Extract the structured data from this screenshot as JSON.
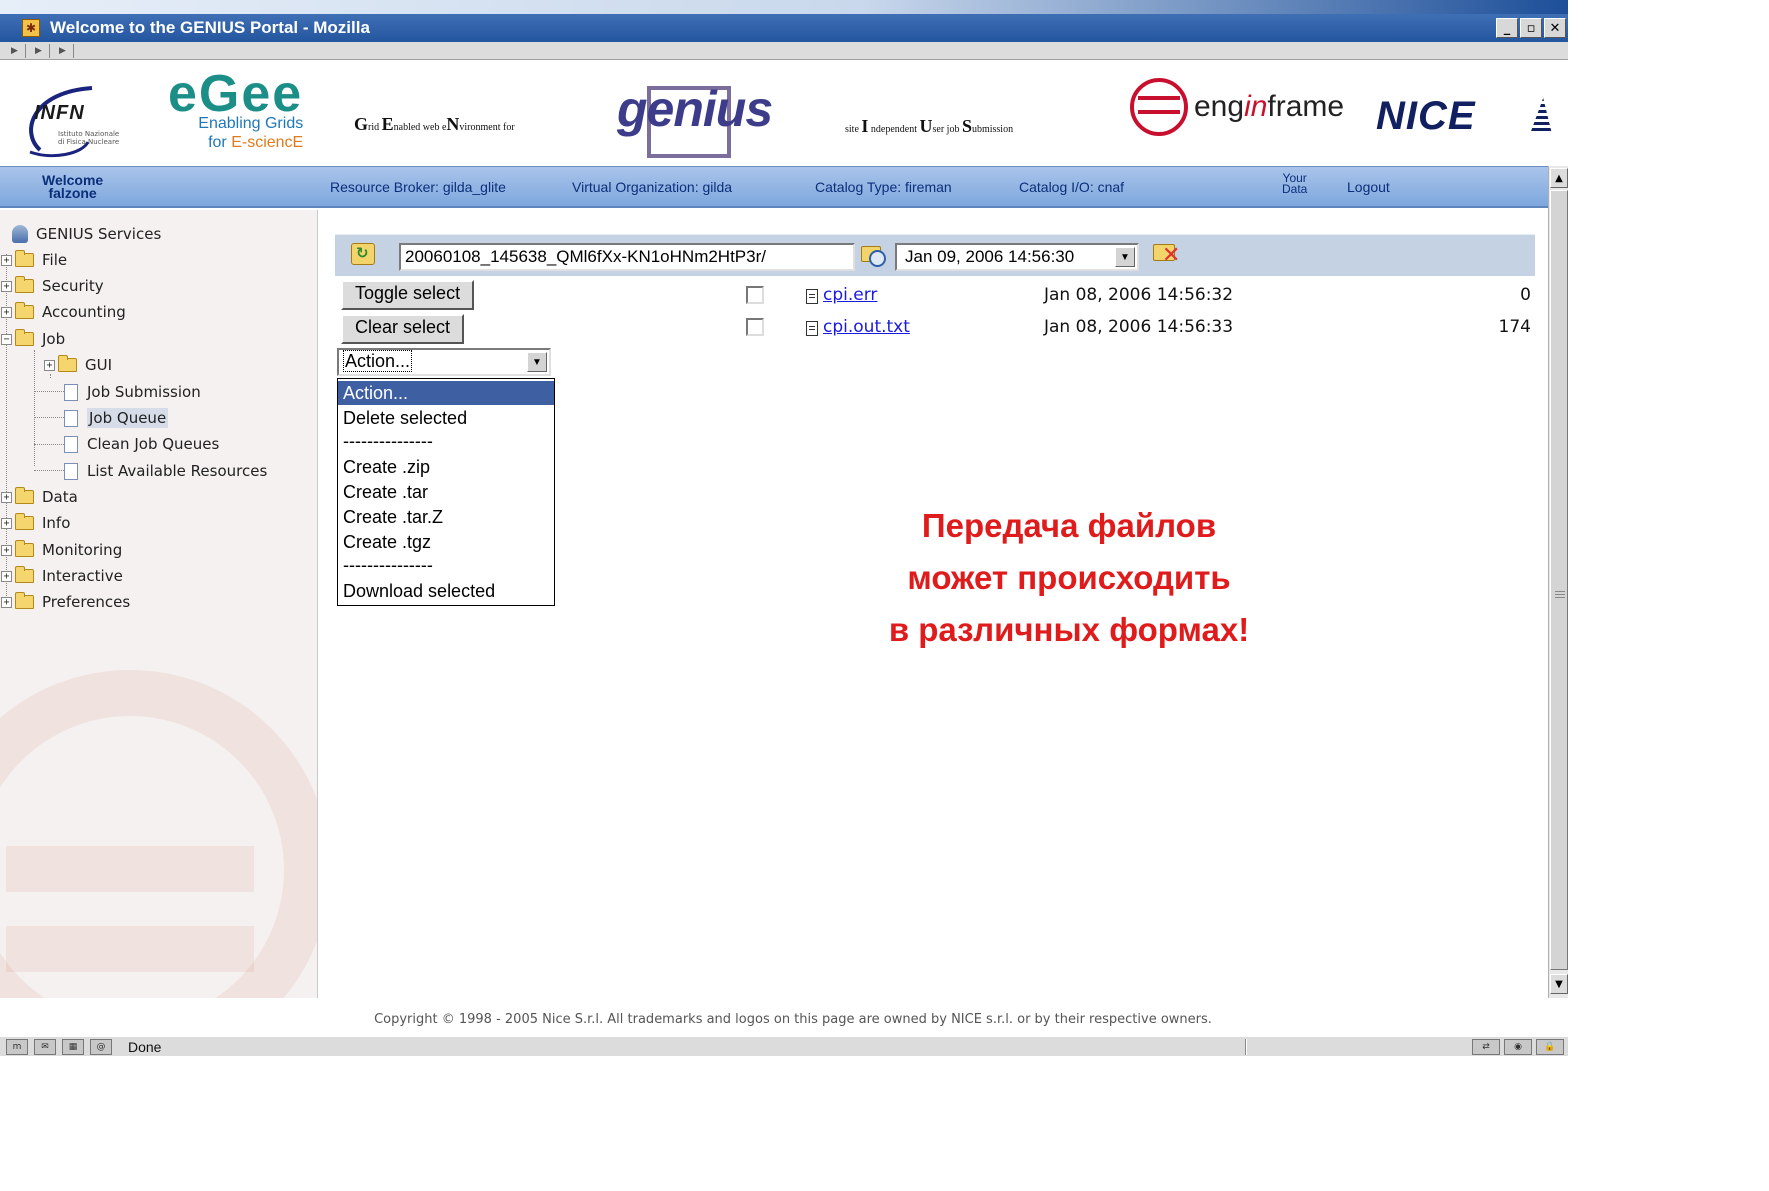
{
  "window": {
    "title": "Welcome to the GENIUS Portal - Mozilla",
    "controls": [
      "minimize",
      "maximize",
      "close"
    ]
  },
  "banner": {
    "infn": {
      "name": "INFN",
      "subtitle_1": "Istituto Nazionale",
      "subtitle_2": "di Fisica Nucleare"
    },
    "egee": {
      "brand": "eGee",
      "line1": "Enabling Grids",
      "line2_prefix": "for ",
      "line2_highlight": "E-sciencE"
    },
    "genius_tagline": {
      "g": "G",
      "g_rest": "rid ",
      "e": "E",
      "e_rest": "nabled web e",
      "n": "N",
      "n_rest": "vironment for"
    },
    "genius_logo": "genius",
    "site_tagline": {
      "p1": "site ",
      "i": "I",
      "p2": " ndependent ",
      "u": "U",
      "p3": "ser job ",
      "s": "S",
      "p4": "ubmission"
    },
    "enginframe": {
      "pre": "eng",
      "mid": "in",
      "post": "frame"
    },
    "nice": "NICE"
  },
  "infobar": {
    "welcome_line1": "Welcome",
    "welcome_line2": "falzone",
    "resource_broker": "Resource Broker: gilda_glite",
    "virtual_org": "Virtual Organization: gilda",
    "catalog_type": "Catalog Type: fireman",
    "catalog_io": "Catalog I/O: cnaf",
    "your_data_1": "Your",
    "your_data_2": "Data",
    "logout": "Logout"
  },
  "sidebar": {
    "root": "GENIUS Services",
    "items": {
      "file": "File",
      "security": "Security",
      "accounting": "Accounting",
      "job": "Job",
      "gui": "GUI",
      "job_submission": "Job Submission",
      "job_queue": "Job Queue",
      "clean_job_queues": "Clean Job Queues",
      "list_resources": "List Available Resources",
      "data": "Data",
      "info": "Info",
      "monitoring": "Monitoring",
      "interactive": "Interactive",
      "preferences": "Preferences"
    },
    "selected": "Job Queue"
  },
  "toolbar": {
    "path_value": "20060108_145638_QMl6fXx-KN1oHNm2HtP3r/",
    "date_value": "Jan 09, 2006 14:56:30"
  },
  "buttons": {
    "toggle_select": "Toggle select",
    "clear_select": "Clear select"
  },
  "files": [
    {
      "name": "cpi.err",
      "date": "Jan 08, 2006 14:56:32",
      "size": "0",
      "checked": false
    },
    {
      "name": "cpi.out.txt",
      "date": "Jan 08, 2006 14:56:33",
      "size": "174",
      "checked": false
    }
  ],
  "action": {
    "selected": "Action...",
    "options": {
      "action": "Action...",
      "delete": "Delete selected",
      "sep1": "---------------",
      "zip": "Create .zip",
      "tar": "Create .tar",
      "tarz": "Create .tar.Z",
      "tgz": "Create .tgz",
      "sep2": "---------------",
      "download": "Download selected"
    },
    "highlighted": "Action..."
  },
  "annotation": {
    "line1": "Передача файлов",
    "line2": "может происходить",
    "line3": "в различных формах!"
  },
  "footer": {
    "copyright": "Copyright © 1998 - 2005 Nice S.r.l. All trademarks and logos on this page are owned by NICE s.r.l. or by their respective owners."
  },
  "statusbar": {
    "status": "Done"
  },
  "colors": {
    "titlebar": "#2b5ea6",
    "infobar": "#8fb2e2",
    "annotation": "#e01b1b",
    "link": "#1a1ae0",
    "highlight": "#3f5fa3"
  }
}
